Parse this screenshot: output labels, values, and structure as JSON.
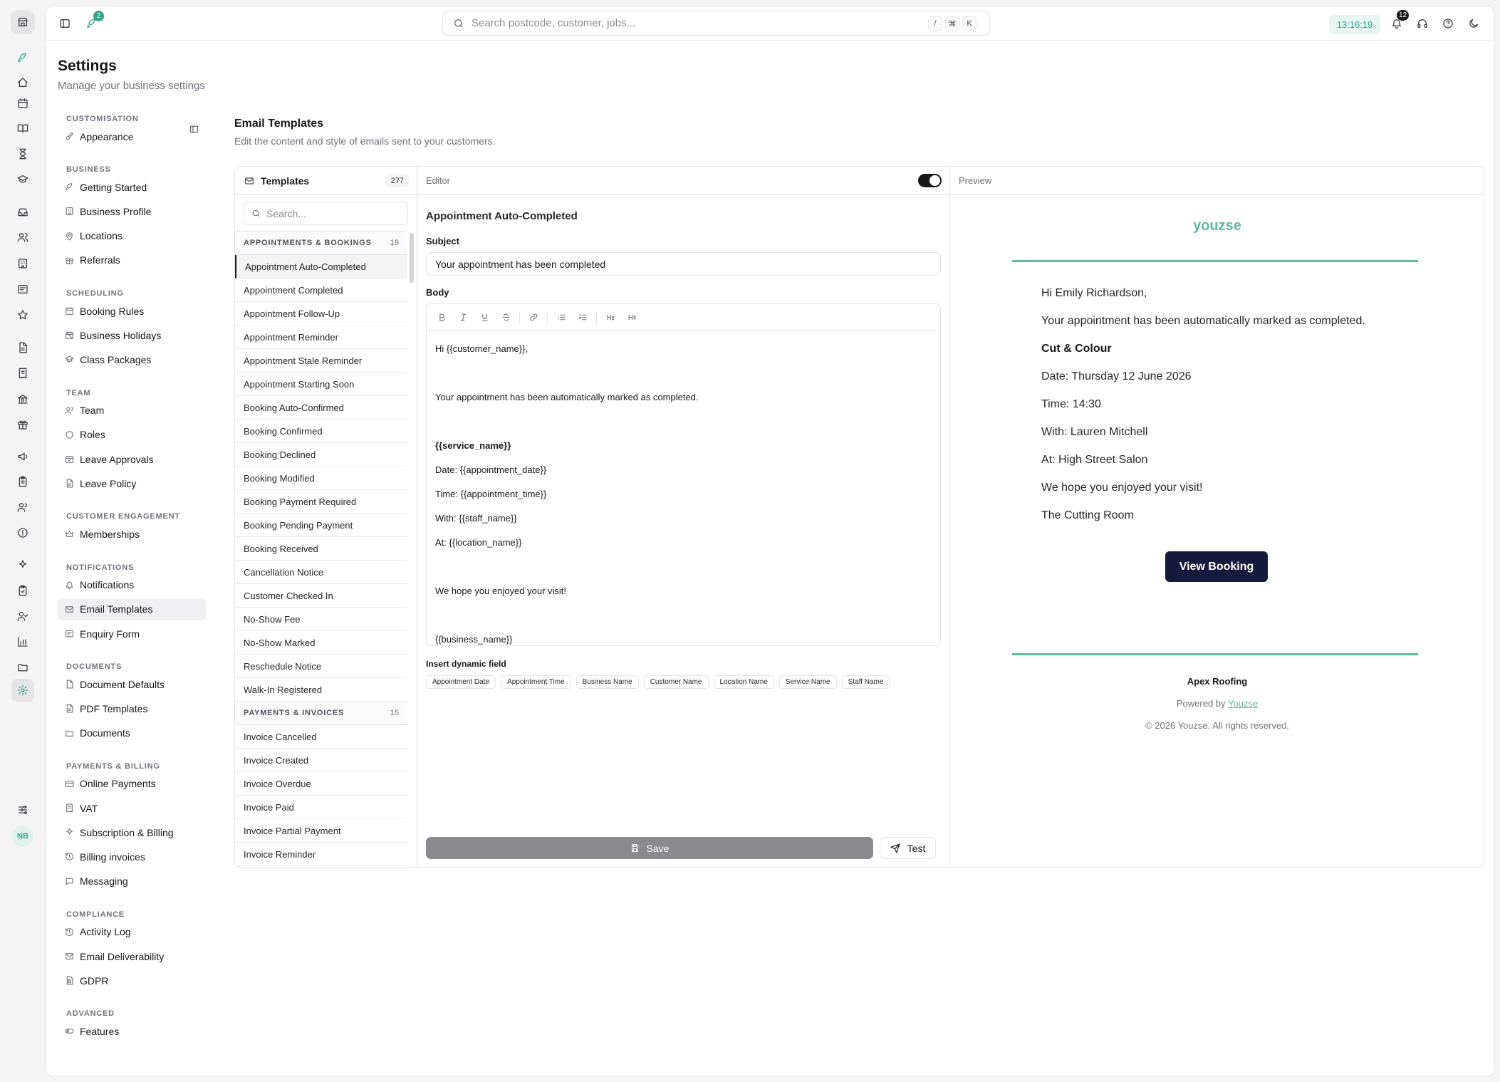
{
  "topbar": {
    "launch_badge": "2",
    "search_placeholder": "Search postcode, customer, jobs...",
    "kbd": [
      "/",
      "⌘",
      "K"
    ],
    "clock": "13:16:19",
    "notif_badge": "12"
  },
  "rail": {
    "avatar": "NB"
  },
  "page": {
    "title": "Settings",
    "subtitle": "Manage your business settings"
  },
  "nav": {
    "sections": [
      {
        "label": "Customisation",
        "items": [
          {
            "label": "Appearance",
            "icon": "paintbrush-icon"
          }
        ]
      },
      {
        "label": "Business",
        "items": [
          {
            "label": "Getting Started",
            "icon": "rocket-icon"
          },
          {
            "label": "Business Profile",
            "icon": "building-icon"
          },
          {
            "label": "Locations",
            "icon": "map-pin-icon"
          },
          {
            "label": "Referrals",
            "icon": "gift-icon"
          }
        ]
      },
      {
        "label": "Scheduling",
        "items": [
          {
            "label": "Booking Rules",
            "icon": "calendar-icon"
          },
          {
            "label": "Business Holidays",
            "icon": "calendar-off-icon"
          },
          {
            "label": "Class Packages",
            "icon": "graduation-cap-icon"
          }
        ]
      },
      {
        "label": "Team",
        "items": [
          {
            "label": "Team",
            "icon": "users-icon"
          },
          {
            "label": "Roles",
            "icon": "shield-icon"
          },
          {
            "label": "Leave Approvals",
            "icon": "calendar-check-icon"
          },
          {
            "label": "Leave Policy",
            "icon": "file-text-icon"
          }
        ]
      },
      {
        "label": "Customer Engagement",
        "items": [
          {
            "label": "Memberships",
            "icon": "crown-icon"
          }
        ]
      },
      {
        "label": "Notifications",
        "items": [
          {
            "label": "Notifications",
            "icon": "bell-icon"
          },
          {
            "label": "Email Templates",
            "icon": "mail-icon",
            "active": true
          },
          {
            "label": "Enquiry Form",
            "icon": "form-icon"
          }
        ]
      },
      {
        "label": "Documents",
        "items": [
          {
            "label": "Document Defaults",
            "icon": "file-icon"
          },
          {
            "label": "PDF Templates",
            "icon": "file-text-icon"
          },
          {
            "label": "Documents",
            "icon": "folder-icon"
          }
        ]
      },
      {
        "label": "Payments & Billing",
        "items": [
          {
            "label": "Online Payments",
            "icon": "credit-card-icon"
          },
          {
            "label": "VAT",
            "icon": "receipt-icon"
          },
          {
            "label": "Subscription & Billing",
            "icon": "sparkles-icon"
          },
          {
            "label": "Billing invoices",
            "icon": "history-icon"
          },
          {
            "label": "Messaging",
            "icon": "message-icon"
          }
        ]
      },
      {
        "label": "Compliance",
        "items": [
          {
            "label": "Activity Log",
            "icon": "history-icon"
          },
          {
            "label": "Email Deliverability",
            "icon": "mail-check-icon"
          },
          {
            "label": "GDPR",
            "icon": "file-lock-icon"
          }
        ]
      },
      {
        "label": "Advanced",
        "items": [
          {
            "label": "Features",
            "icon": "toggle-icon"
          }
        ]
      }
    ]
  },
  "section": {
    "title": "Email Templates",
    "subtitle": "Edit the content and style of emails sent to your customers."
  },
  "list": {
    "title": "Templates",
    "count": "277",
    "search_placeholder": "Search...",
    "groups": [
      {
        "label": "Appointments & Bookings",
        "count": "19",
        "items": [
          "Appointment Auto-Completed",
          "Appointment Completed",
          "Appointment Follow-Up",
          "Appointment Reminder",
          "Appointment Stale Reminder",
          "Appointment Starting Soon",
          "Booking Auto-Confirmed",
          "Booking Confirmed",
          "Booking Declined",
          "Booking Modified",
          "Booking Payment Required",
          "Booking Pending Payment",
          "Booking Received",
          "Cancellation Notice",
          "Customer Checked In",
          "No-Show Fee",
          "No-Show Marked",
          "Reschedule Notice",
          "Walk-In Registered"
        ]
      },
      {
        "label": "Payments & Invoices",
        "count": "15",
        "items": [
          "Invoice Cancelled",
          "Invoice Created",
          "Invoice Overdue",
          "Invoice Paid",
          "Invoice Partial Payment",
          "Invoice Reminder"
        ]
      }
    ],
    "selected": "Appointment Auto-Completed"
  },
  "editor": {
    "label": "Editor",
    "template_name": "Appointment Auto-Completed",
    "subject_label": "Subject",
    "subject_value": "Your appointment has been completed",
    "body_label": "Body",
    "body_lines": [
      {
        "text": "Hi {{customer_name}},"
      },
      {
        "text": ""
      },
      {
        "text": "Your appointment has been automatically marked as completed."
      },
      {
        "text": ""
      },
      {
        "text": "{{service_name}}",
        "bold": true
      },
      {
        "text": "Date: {{appointment_date}}"
      },
      {
        "text": "Time: {{appointment_time}}"
      },
      {
        "text": "With: {{staff_name}}"
      },
      {
        "text": "At: {{location_name}}"
      },
      {
        "text": ""
      },
      {
        "text": "We hope you enjoyed your visit!"
      },
      {
        "text": ""
      },
      {
        "text": "{{business_name}}"
      }
    ],
    "dynamic_label": "Insert dynamic field",
    "dynamic_fields": [
      "Appointment Date",
      "Appointment Time",
      "Business Name",
      "Customer Name",
      "Location Name",
      "Service Name",
      "Staff Name"
    ],
    "save_label": "Save",
    "test_label": "Test"
  },
  "preview": {
    "label": "Preview",
    "brand": "youzse",
    "lines": [
      {
        "text": "Hi Emily Richardson,"
      },
      {
        "text": "Your appointment has been automatically marked as completed."
      },
      {
        "text": "Cut & Colour",
        "bold": true
      },
      {
        "text": "Date: Thursday 12 June 2026"
      },
      {
        "text": "Time: 14:30"
      },
      {
        "text": "With: Lauren Mitchell"
      },
      {
        "text": "At: High Street Salon"
      },
      {
        "text": "We hope you enjoyed your visit!"
      },
      {
        "text": "The Cutting Room"
      }
    ],
    "button_label": "View Booking",
    "company": "Apex Roofing",
    "powered_prefix": "Powered by",
    "powered_link": "Youzse",
    "copyright": "© 2026 Youzse. All rights reserved."
  },
  "colors": {
    "accent": "#34a38a",
    "preview_accent": "#5fb8a2",
    "cta": "#151a3d"
  }
}
